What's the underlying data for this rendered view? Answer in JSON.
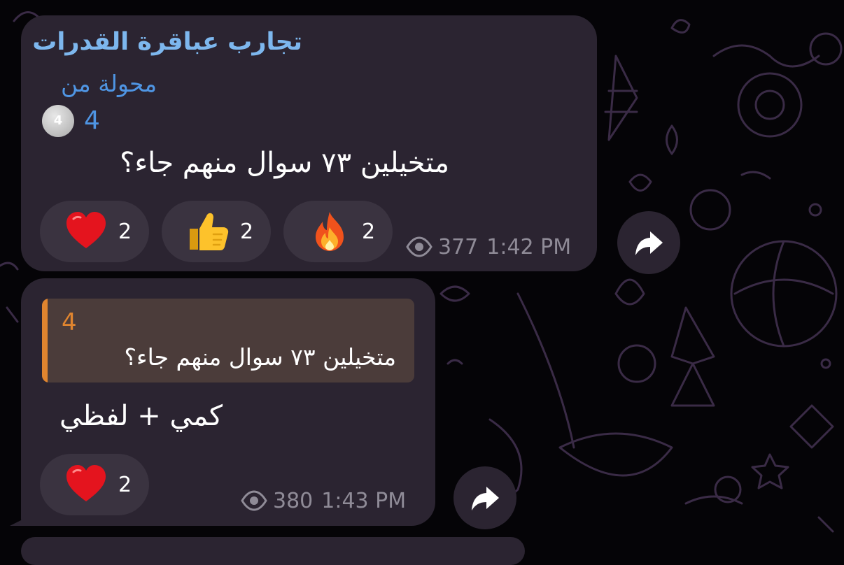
{
  "messages": [
    {
      "channel_title": "تجارب عباقرة القدرات",
      "forwarded_label": "محولة من",
      "forwarded_from": {
        "avatar_text": "4",
        "name": "4"
      },
      "text": "متخيلين ٧٣ سوال منهم جاء؟",
      "reactions": [
        {
          "icon": "heart-emoji",
          "count": "2"
        },
        {
          "icon": "thumbs-up-emoji",
          "count": "2"
        },
        {
          "icon": "fire-emoji",
          "count": "2"
        }
      ],
      "views": "377",
      "time": "1:42 PM"
    },
    {
      "reply_to": {
        "name": "4",
        "text": "متخيلين ٧٣ سوال منهم جاء؟"
      },
      "text": "كمي + لفظي",
      "reactions": [
        {
          "icon": "heart-emoji",
          "count": "2"
        }
      ],
      "views": "380",
      "time": "1:43 PM"
    }
  ],
  "colors": {
    "bubble": "#2b2431",
    "reaction_bg": "#3a3340",
    "channel_title": "#7db7ee",
    "forward_link": "#4f95e3",
    "reply_accent": "#e0852f",
    "reply_bg": "#4b3c3a",
    "meta_text": "#8f8b97"
  },
  "icons": {
    "views": "eye-icon",
    "share": "share-arrow-icon"
  }
}
